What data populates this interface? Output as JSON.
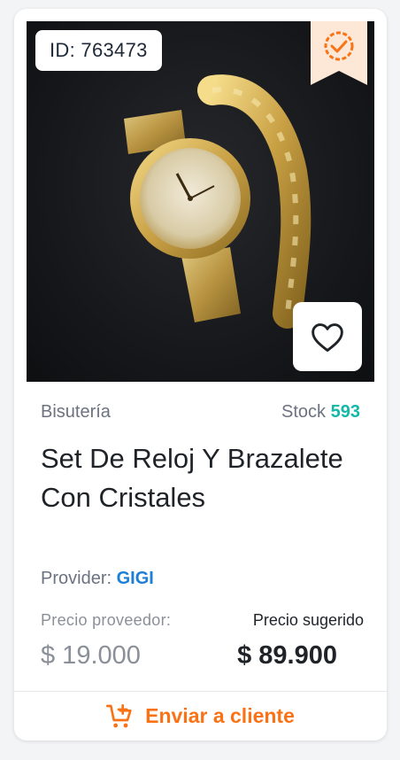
{
  "product": {
    "id_label": "ID: 763473",
    "category": "Bisutería",
    "stock_label": "Stock",
    "stock_value": "593",
    "title": "Set De Reloj Y Brazalete Con Cristales",
    "provider_label": "Provider:",
    "provider_name": "GIGI",
    "supplier_price_label": "Precio proveedor:",
    "suggested_price_label": "Precio sugerido",
    "supplier_price": "$ 19.000",
    "suggested_price": "$ 89.900"
  },
  "actions": {
    "send_label": "Enviar a cliente"
  },
  "icons": {
    "verified": "verified-badge-icon",
    "favorite": "heart-icon",
    "send": "cart-plus-icon"
  },
  "colors": {
    "accent": "#f97316",
    "stock": "#14b8a6",
    "provider_link": "#1d7fd6"
  }
}
